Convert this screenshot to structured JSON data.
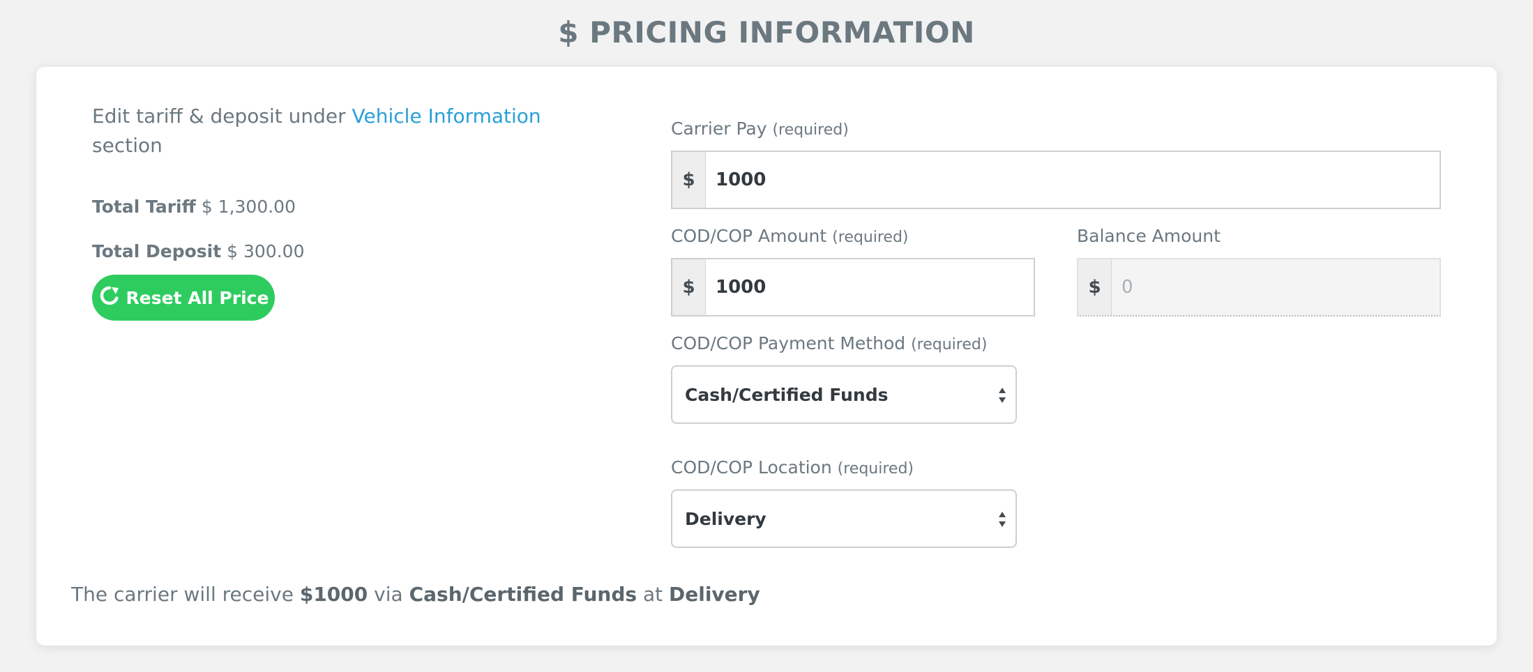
{
  "page": {
    "title": "$ PRICING INFORMATION"
  },
  "left": {
    "note_prefix": "Edit tariff & deposit under",
    "note_link": "Vehicle Information",
    "note_suffix": "section",
    "total_tariff_label": "Total Tariff",
    "total_tariff_value": "$ 1,300.00",
    "total_deposit_label": "Total Deposit",
    "total_deposit_value": "$ 300.00",
    "reset_button": "Reset All Price"
  },
  "form": {
    "currency": "$",
    "carrier_pay": {
      "label": "Carrier Pay",
      "hint": "(required)",
      "value": "1000"
    },
    "cod_amount": {
      "label": "COD/COP Amount",
      "hint": "(required)",
      "value": "1000"
    },
    "balance_amount": {
      "label": "Balance Amount",
      "value": "0"
    },
    "payment_method": {
      "label": "COD/COP Payment Method",
      "hint": "(required)",
      "selected": "Cash/Certified Funds"
    },
    "location": {
      "label": "COD/COP Location",
      "hint": "(required)",
      "selected": "Delivery"
    }
  },
  "summary": {
    "prefix": "The carrier will receive",
    "amount": "$1000",
    "via": "via",
    "method": "Cash/Certified Funds",
    "at": "at",
    "location": "Delivery"
  },
  "colors": {
    "accent_green": "#2ecc5f",
    "link_blue": "#2a9fd8",
    "text": "#6b7880"
  },
  "icons": {
    "reset": "refresh-icon",
    "select": "up-down-arrows-icon"
  }
}
